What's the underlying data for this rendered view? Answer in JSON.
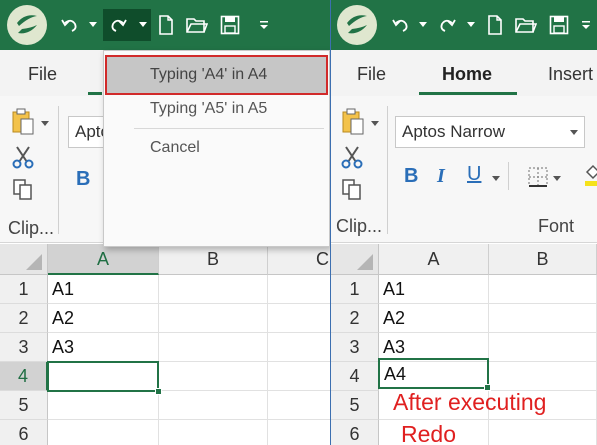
{
  "left": {
    "tabs": [
      {
        "label": "File"
      }
    ],
    "ribbon": {
      "font_name": "Apto",
      "bold_label": "B",
      "clipboard_group_label": "Clip..."
    },
    "columns": [
      {
        "label": "A"
      },
      {
        "label": "B"
      },
      {
        "label": "C"
      }
    ],
    "rows": [
      {
        "num": "1",
        "cells": [
          "A1",
          ""
        ]
      },
      {
        "num": "2",
        "cells": [
          "A2",
          ""
        ]
      },
      {
        "num": "3",
        "cells": [
          "A3",
          ""
        ]
      },
      {
        "num": "4",
        "cells": [
          "",
          ""
        ]
      },
      {
        "num": "5",
        "cells": [
          "",
          ""
        ]
      },
      {
        "num": "6",
        "cells": [
          "",
          ""
        ]
      }
    ],
    "redo_menu": {
      "items": [
        {
          "label": "Typing 'A4' in A4",
          "highlighted": true
        },
        {
          "label": "Typing 'A5' in A5",
          "highlighted": false
        }
      ],
      "cancel_label": "Cancel"
    }
  },
  "right": {
    "tabs": [
      {
        "label": "File"
      },
      {
        "label": "Home",
        "active": true
      },
      {
        "label": "Insert"
      }
    ],
    "ribbon": {
      "font_name": "Aptos Narrow",
      "bold_label": "B",
      "italic_label": "I",
      "underline_label": "U",
      "clipboard_group_label": "Clip...",
      "font_group_label": "Font"
    },
    "columns": [
      {
        "label": "A"
      },
      {
        "label": "B"
      }
    ],
    "rows": [
      {
        "num": "1",
        "cells": [
          "A1",
          ""
        ]
      },
      {
        "num": "2",
        "cells": [
          "A2",
          ""
        ]
      },
      {
        "num": "3",
        "cells": [
          "A3",
          ""
        ]
      },
      {
        "num": "4",
        "cells": [
          "A4",
          ""
        ]
      },
      {
        "num": "5",
        "cells": [
          "",
          ""
        ]
      },
      {
        "num": "6",
        "cells": [
          "",
          ""
        ]
      }
    ],
    "annotation": {
      "line1": "After executing",
      "line2": "Redo"
    }
  },
  "colors": {
    "title_bar": "#217346",
    "selection": "#217346",
    "highlight_outline": "#d12a2a",
    "annotation": "#e02020",
    "format_icons": "#2a6eb8"
  },
  "icons": {
    "app_logo": "app-logo-icon",
    "undo": "undo-icon",
    "redo": "redo-icon",
    "new_file": "new-file-icon",
    "open_folder": "open-folder-icon",
    "save": "save-icon",
    "customize": "customize-toolbar-icon",
    "paste": "paste-icon",
    "cut": "cut-icon",
    "copy": "copy-icon",
    "borders": "borders-icon",
    "fill_color": "fill-color-icon"
  }
}
